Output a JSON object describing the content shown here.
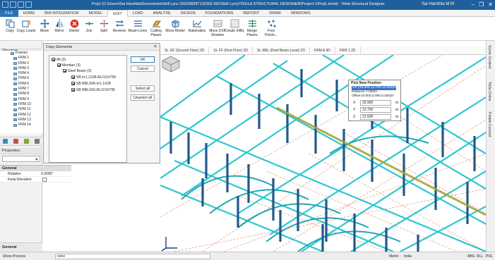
{
  "titlebar": {
    "title": "Proj1 (C:\\Users\\Sai Harshita\\Documents\\Skill Lync-20220828T132302-001\\Skill Lync)\\TEKLA STRUCTURAL DESIGNER\\Project 1\\Proj1.tsmd) - Tekla Structural Designer",
    "user": "Sai Harshita M M",
    "controls": [
      "–",
      "❐",
      "✕"
    ]
  },
  "menu_tabs": [
    "FILE",
    "HOME",
    "BIM INTEGRATION",
    "MODEL",
    "EDIT",
    "LOAD",
    "ANALYSE",
    "DESIGN",
    "FOUNDATIONS",
    "REPORT",
    "DRAW",
    "WINDOWS"
  ],
  "active_tab": "EDIT",
  "ribbon": {
    "buttons": [
      {
        "label": "Copy",
        "icon": "copy-icon"
      },
      {
        "label": "Copy Loads",
        "icon": "copy-loads-icon"
      },
      {
        "label": "Move",
        "icon": "move-icon"
      },
      {
        "label": "Mirror",
        "icon": "mirror-icon"
      },
      {
        "label": "Delete",
        "icon": "delete-icon"
      },
      {
        "label": "Join",
        "icon": "join-icon"
      },
      {
        "label": "Split",
        "icon": "split-icon"
      },
      {
        "label": "Reverse",
        "icon": "reverse-icon"
      },
      {
        "label": "Beam Lines",
        "icon": "beam-lines-icon"
      },
      {
        "label": "Cutting Planes",
        "icon": "cutting-planes-icon"
      },
      {
        "label": "Move Model",
        "icon": "move-model-icon"
      },
      {
        "label": "Rationalize",
        "icon": "rationalize-icon"
      },
      {
        "label": "Move DXF Shadow",
        "icon": "dxf-shadow-icon"
      },
      {
        "label": "Create Infills",
        "icon": "create-infills-icon"
      },
      {
        "label": "Merge Planes",
        "icon": "merge-planes-icon"
      },
      {
        "label": "Free Points...",
        "icon": "free-points-icon"
      }
    ]
  },
  "structure": {
    "heading": "Structure",
    "parent": "Frames",
    "items": [
      "FRM 1",
      "FRM 2",
      "FRM 3",
      "FRM 4",
      "FRM 5",
      "FRM 6",
      "FRM 7",
      "FRM 8",
      "FRM 9",
      "FRM 10",
      "FRM 11",
      "FRM 12",
      "FRM 13",
      "FRM 14"
    ]
  },
  "properties": {
    "heading": "Properties",
    "section": "General",
    "rows": [
      {
        "key": "Rotation",
        "value": "0.0000°"
      },
      {
        "key": "Keep Elevation",
        "value": ""
      }
    ],
    "bottom_tab": "General"
  },
  "copy_dialog": {
    "title": "Copy Elements",
    "tree": [
      {
        "label": "All (3)",
        "level": 0
      },
      {
        "label": "Member (3)",
        "level": 1
      },
      {
        "label": "Steel Beam (3)",
        "level": 2
      },
      {
        "label": "SB Irr1.1/1/B-RL/1/1#795",
        "level": 3
      },
      {
        "label": "SB RBL/3/A-Irr1.1/1/B",
        "level": 3
      },
      {
        "label": "SB RBL/3/G-RL/1/1#795",
        "level": 3
      }
    ],
    "buttons": {
      "ok": "OK",
      "cancel": "Cancel",
      "select_all": "Select all",
      "unselect_all": "Unselect all"
    }
  },
  "view_tabs": [
    "St. GF (Ground Floor) 2D",
    "St. FF (First Floor) 2D",
    "St. RBL (Roof Beam Level) 2D",
    "FRM A 3D",
    "FRM 1 2D"
  ],
  "pick_dialog": {
    "title": "Pick New Position",
    "info": [
      "GP (33.900,13.700,12.500)m",
      "Distance 7.000m",
      "Offset (0.000,0.000,0.000)m"
    ],
    "fields": [
      {
        "label": "X",
        "value": "33.900",
        "unit": "m"
      },
      {
        "label": "Y",
        "value": "13.700",
        "unit": "m"
      },
      {
        "label": "Z",
        "value": "12.500",
        "unit": "m"
      }
    ]
  },
  "right_panels": [
    "Scene Content",
    "Tekla Online",
    "Trimble Connect"
  ],
  "status": {
    "show_process": "Show Process",
    "command": "none",
    "metric": "Metric",
    "region": "India",
    "flags": [
      "ABS",
      "RLL",
      "POL"
    ]
  },
  "colors": {
    "accent": "#1f5f9c",
    "column": "#22618f",
    "beam": "#2ec6cf",
    "ghost": "#a6a53a",
    "grid": "#d9603a"
  }
}
